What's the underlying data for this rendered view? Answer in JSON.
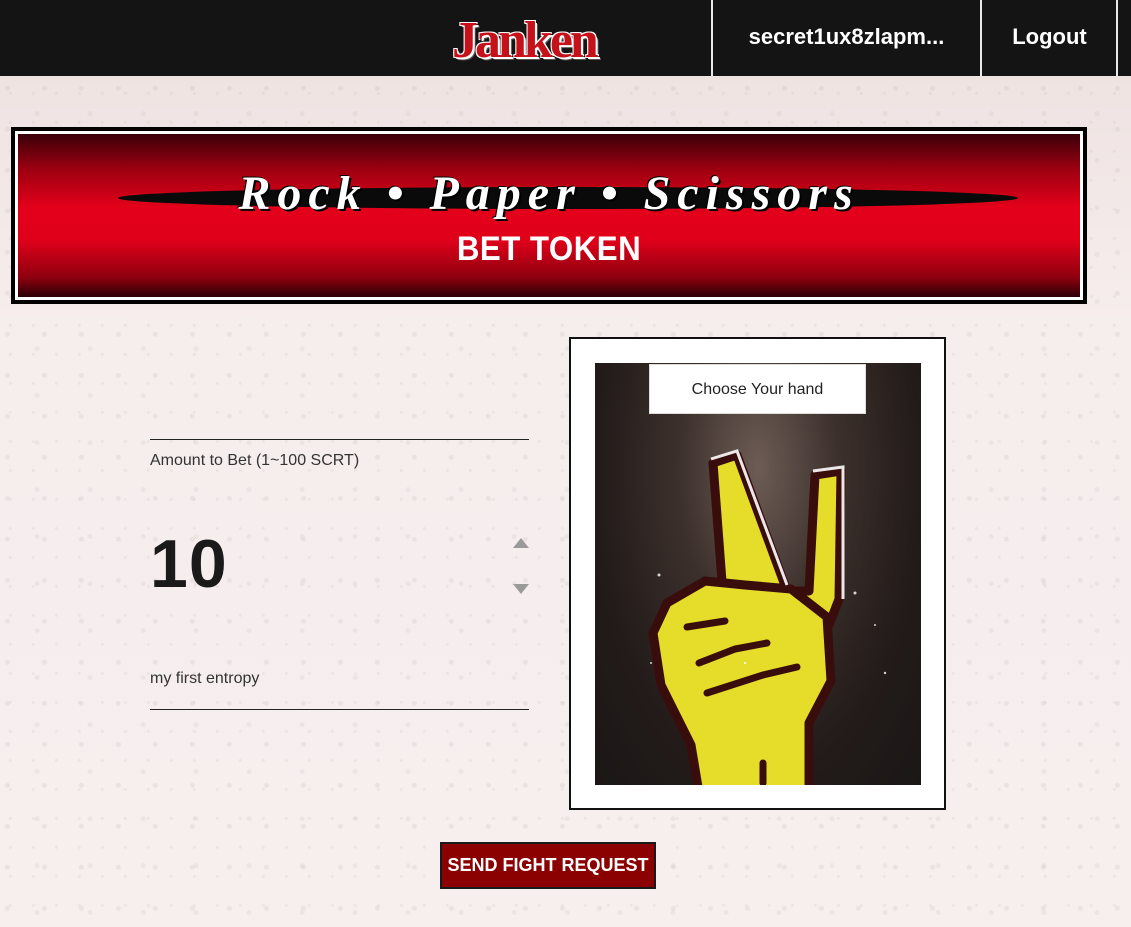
{
  "header": {
    "logo_text": "Janken",
    "wallet_address": "secret1ux8zlapm...",
    "logout_label": "Logout"
  },
  "banner": {
    "title": "Rock • Paper • Scissors",
    "subtitle": "BET TOKEN"
  },
  "form": {
    "amount_label": "Amount to Bet (1~100 SCRT)",
    "amount_value": "10",
    "entropy_value": "my first entropy"
  },
  "hand_picker": {
    "button_label": "Choose Your hand",
    "selected_hand": "scissors",
    "hand_icon": "peace-hand-icon"
  },
  "actions": {
    "send_label": "SEND FIGHT REQUEST"
  },
  "colors": {
    "header_bg": "#141414",
    "brand_red": "#c5111a",
    "button_red": "#8b0000",
    "hand_yellow": "#e6dc2a"
  }
}
